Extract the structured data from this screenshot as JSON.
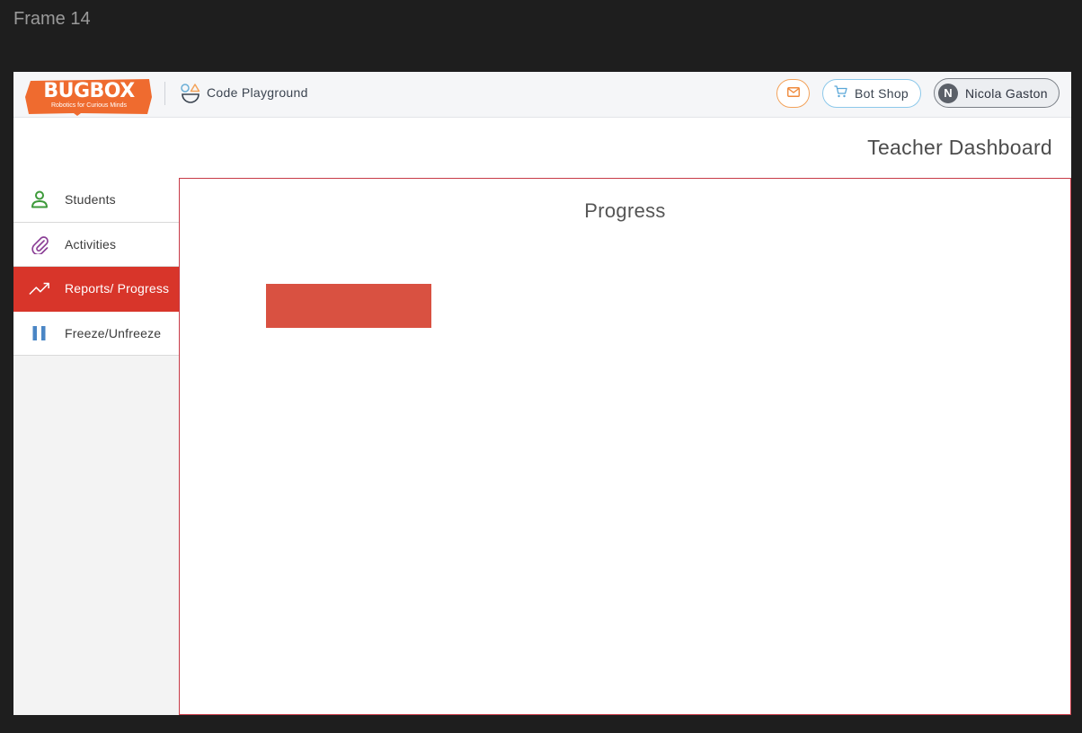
{
  "canvas": {
    "frame_label": "Frame 14"
  },
  "topbar": {
    "logo": {
      "name": "BUGBOX",
      "tagline": "Robotics for Curious Minds",
      "color": "#ef6b2f"
    },
    "code_playground_label": "Code Playground",
    "mail_icon": "envelope-icon",
    "bot_shop_label": "Bot Shop",
    "user": {
      "initial": "N",
      "name": "Nicola Gaston"
    }
  },
  "header": {
    "title": "Teacher Dashboard"
  },
  "sidebar": {
    "items": [
      {
        "label": "Students",
        "icon": "person-icon",
        "icon_color": "#3d9a3a",
        "active": false
      },
      {
        "label": "Activities",
        "icon": "paperclip-icon",
        "icon_color": "#8b3f96",
        "active": false
      },
      {
        "label": "Reports/ Progress",
        "icon": "trending-up-icon",
        "icon_color": "#ffffff",
        "active": true
      },
      {
        "label": "Freeze/Unfreeze",
        "icon": "pause-icon",
        "icon_color": "#4a86c5",
        "active": false
      }
    ],
    "active_color": "#d8352a"
  },
  "main": {
    "title": "Progress",
    "block_color": "#d95141"
  }
}
